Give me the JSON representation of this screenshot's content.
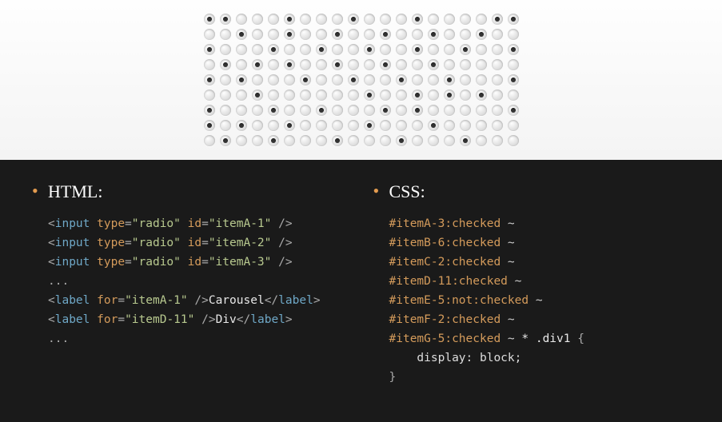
{
  "radio_grid": {
    "cols": 20,
    "rows": 9,
    "checked": [
      [
        0,
        0
      ],
      [
        1,
        0
      ],
      [
        5,
        0
      ],
      [
        9,
        0
      ],
      [
        13,
        0
      ],
      [
        18,
        0
      ],
      [
        19,
        0
      ],
      [
        2,
        1
      ],
      [
        5,
        1
      ],
      [
        8,
        1
      ],
      [
        11,
        1
      ],
      [
        14,
        1
      ],
      [
        17,
        1
      ],
      [
        0,
        2
      ],
      [
        4,
        2
      ],
      [
        7,
        2
      ],
      [
        10,
        2
      ],
      [
        13,
        2
      ],
      [
        16,
        2
      ],
      [
        19,
        2
      ],
      [
        1,
        3
      ],
      [
        3,
        3
      ],
      [
        5,
        3
      ],
      [
        8,
        3
      ],
      [
        11,
        3
      ],
      [
        14,
        3
      ],
      [
        0,
        4
      ],
      [
        2,
        4
      ],
      [
        6,
        4
      ],
      [
        9,
        4
      ],
      [
        12,
        4
      ],
      [
        15,
        4
      ],
      [
        19,
        4
      ],
      [
        3,
        5
      ],
      [
        10,
        5
      ],
      [
        13,
        5
      ],
      [
        15,
        5
      ],
      [
        17,
        5
      ],
      [
        0,
        6
      ],
      [
        4,
        6
      ],
      [
        7,
        6
      ],
      [
        11,
        6
      ],
      [
        13,
        6
      ],
      [
        19,
        6
      ],
      [
        0,
        7
      ],
      [
        2,
        7
      ],
      [
        5,
        7
      ],
      [
        10,
        7
      ],
      [
        14,
        7
      ],
      [
        1,
        8
      ],
      [
        4,
        8
      ],
      [
        8,
        8
      ],
      [
        12,
        8
      ],
      [
        16,
        8
      ]
    ]
  },
  "headings": {
    "html": "HTML:",
    "css": "CSS:"
  },
  "html_code": [
    {
      "type": "input",
      "attrs": [
        [
          "type",
          "radio"
        ],
        [
          "id",
          "itemA-1"
        ]
      ]
    },
    {
      "type": "input",
      "attrs": [
        [
          "type",
          "radio"
        ],
        [
          "id",
          "itemA-2"
        ]
      ]
    },
    {
      "type": "input",
      "attrs": [
        [
          "type",
          "radio"
        ],
        [
          "id",
          "itemA-3"
        ]
      ]
    },
    {
      "type": "ellipsis"
    },
    {
      "type": "label",
      "attrs": [
        [
          "for",
          "itemA-1"
        ]
      ],
      "text": "Carousel"
    },
    {
      "type": "label",
      "attrs": [
        [
          "for",
          "itemD-11"
        ]
      ],
      "text": "Div"
    },
    {
      "type": "ellipsis"
    }
  ],
  "css_code": {
    "selectors": [
      {
        "id": "itemA-3",
        "pseudo": "checked"
      },
      {
        "id": "itemB-6",
        "pseudo": "checked"
      },
      {
        "id": "itemC-2",
        "pseudo": "checked"
      },
      {
        "id": "itemD-11",
        "pseudo": "checked"
      },
      {
        "id": "itemE-5",
        "pseudo": "not:checked"
      },
      {
        "id": "itemF-2",
        "pseudo": "checked"
      },
      {
        "id": "itemG-5",
        "pseudo": "checked",
        "tail": " * .div1 {"
      }
    ],
    "body_line": "    display: block;",
    "close": "}"
  }
}
